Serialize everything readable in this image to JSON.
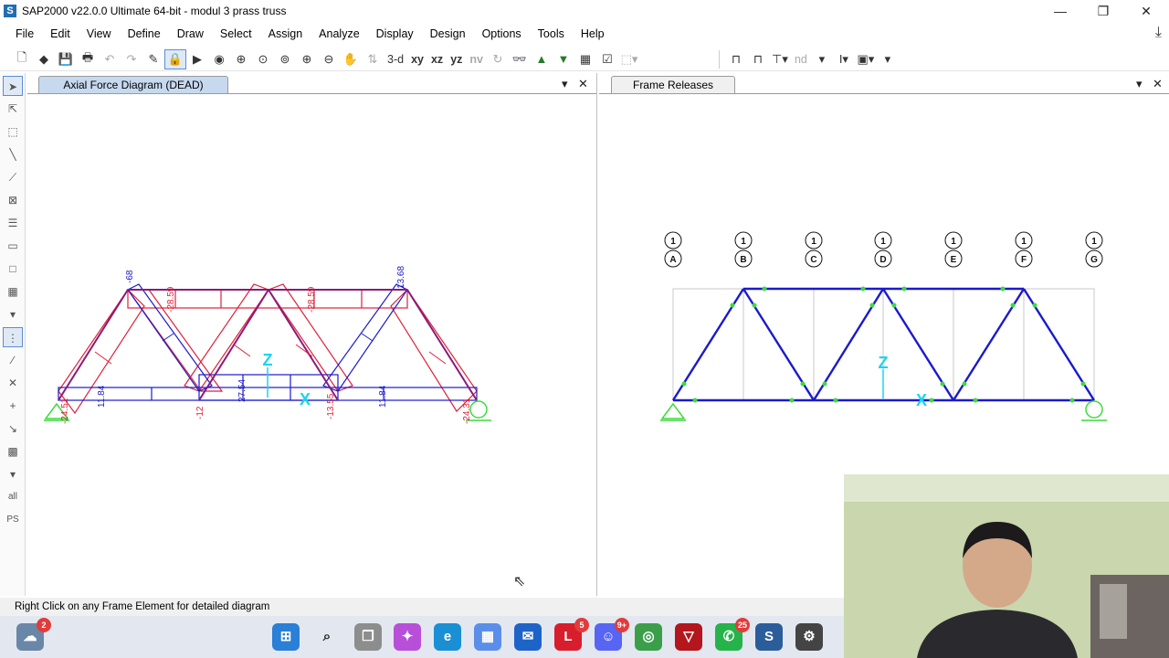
{
  "window": {
    "title": "SAP2000 v22.0.0 Ultimate 64-bit - modul 3 prass truss",
    "app_icon_letter": "S",
    "controls": {
      "minimize": "—",
      "maximize": "❐",
      "close": "✕"
    }
  },
  "menu": [
    "File",
    "Edit",
    "View",
    "Define",
    "Draw",
    "Select",
    "Assign",
    "Analyze",
    "Display",
    "Design",
    "Options",
    "Tools",
    "Help"
  ],
  "toolbar": {
    "view_3d": "3-d",
    "view_xy": "xy",
    "view_xz": "xz",
    "view_yz": "yz",
    "view_nv": "nv",
    "view_nd": "nd"
  },
  "left_tools": {
    "all_label": "all",
    "ps_label": "PS"
  },
  "left_pane": {
    "tab_title": "Axial Force Diagram (DEAD)",
    "labels": {
      "top_left_diag": "-68",
      "top_right_diag": "13.68",
      "top_chord_1": "-28.59",
      "top_chord_2": "-28.59",
      "bottom_1": "11.84",
      "bottom_center": "27.54",
      "bottom_2": "11.84",
      "node_2": "-12",
      "node_4": "-13.55",
      "left_support": "-24.51",
      "right_support": "-24.31"
    },
    "axis_z": "Z",
    "axis_x": "X"
  },
  "right_pane": {
    "tab_title": "Frame Releases",
    "grid_numbers": [
      "1",
      "1",
      "1",
      "1",
      "1",
      "1",
      "1"
    ],
    "grid_letters": [
      "A",
      "B",
      "C",
      "D",
      "E",
      "F",
      "G"
    ],
    "axis_z": "Z",
    "axis_x": "X"
  },
  "status_text": "Right Click on any Frame Element for detailed diagram",
  "taskbar": {
    "badge_left": "2",
    "badge_l": "5",
    "badge_discord": "9+",
    "badge_whatsapp": "25",
    "letter_l": "L"
  },
  "colors": {
    "tab_active": "#c7d9ef",
    "truss_blue": "#1a1acc",
    "compression_red": "#e0203a",
    "tension_purple": "#8b1a7a",
    "support_green": "#3cdc3c",
    "axis_cyan": "#19d5ee"
  }
}
